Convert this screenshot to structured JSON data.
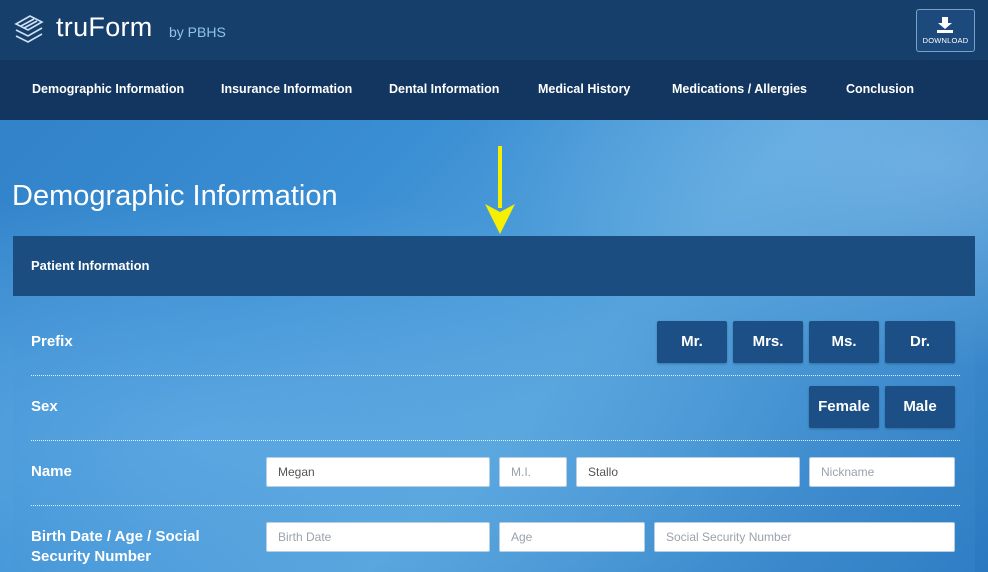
{
  "app": {
    "title": "truForm",
    "subtitle": "by PBHS",
    "download_label": "DOWNLOAD"
  },
  "nav": {
    "items": [
      {
        "label": "Demographic Information"
      },
      {
        "label": "Insurance Information"
      },
      {
        "label": "Dental Information"
      },
      {
        "label": "Medical History"
      },
      {
        "label": "Medications / Allergies"
      },
      {
        "label": "Conclusion"
      }
    ]
  },
  "page": {
    "title": "Demographic Information",
    "section_title": "Patient Information"
  },
  "form": {
    "prefix": {
      "label": "Prefix",
      "options": [
        "Mr.",
        "Mrs.",
        "Ms.",
        "Dr."
      ]
    },
    "sex": {
      "label": "Sex",
      "options": [
        "Female",
        "Male"
      ]
    },
    "name": {
      "label": "Name",
      "first": {
        "value": "Megan",
        "placeholder": ""
      },
      "middle": {
        "value": "",
        "placeholder": "M.I."
      },
      "last": {
        "value": "Stallo",
        "placeholder": ""
      },
      "nickname": {
        "value": "",
        "placeholder": "Nickname"
      }
    },
    "birth": {
      "label_line1": "Birth Date / Age / Social",
      "label_line2": "Security Number",
      "birth_date": {
        "value": "",
        "placeholder": "Birth Date"
      },
      "age": {
        "value": "",
        "placeholder": "Age"
      },
      "ssn": {
        "value": "",
        "placeholder": "Social Security Number"
      }
    }
  },
  "colors": {
    "topbar": "#173f6c",
    "navbar": "#12365f",
    "panel_header": "#1b4d80",
    "button": "#1b4f85",
    "annotation_arrow": "#f5ef00"
  },
  "icons": {
    "logo": "truform-logo-icon",
    "download": "download-icon",
    "annotation": "arrow-down-icon"
  }
}
